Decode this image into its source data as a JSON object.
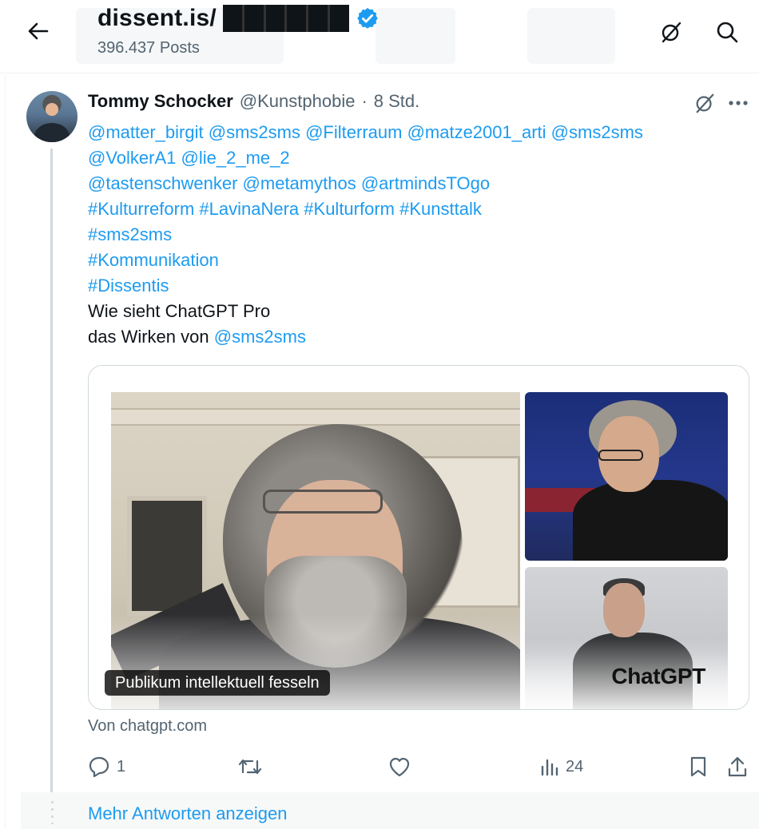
{
  "header": {
    "title": "dissent.is/",
    "post_count": "396.437 Posts"
  },
  "tweet": {
    "display_name": "Tommy Schocker",
    "handle": "@Kunstphobie",
    "separator": "·",
    "time": "8 Std.",
    "lines": [
      [
        {
          "t": "@matter_birgit",
          "link": true
        },
        {
          "t": " ",
          "link": false
        },
        {
          "t": "@sms2sms",
          "link": true
        },
        {
          "t": " ",
          "link": false
        },
        {
          "t": "@Filterraum",
          "link": true
        },
        {
          "t": " ",
          "link": false
        },
        {
          "t": "@matze2001_arti",
          "link": true
        },
        {
          "t": " ",
          "link": false
        },
        {
          "t": "@sms2sms",
          "link": true
        }
      ],
      [
        {
          "t": "@VolkerA1",
          "link": true
        },
        {
          "t": " ",
          "link": false
        },
        {
          "t": "@lie_2_me_2",
          "link": true
        }
      ],
      [
        {
          "t": "@tastenschwenker",
          "link": true
        },
        {
          "t": " ",
          "link": false
        },
        {
          "t": "@metamythos",
          "link": true
        },
        {
          "t": " ",
          "link": false
        },
        {
          "t": "@artmindsTOgo",
          "link": true
        }
      ],
      [
        {
          "t": "#Kulturreform",
          "link": true
        },
        {
          "t": " ",
          "link": false
        },
        {
          "t": "#LavinaNera",
          "link": true
        },
        {
          "t": " ",
          "link": false
        },
        {
          "t": "#Kulturform",
          "link": true
        },
        {
          "t": " ",
          "link": false
        },
        {
          "t": "#Kunsttalk",
          "link": true
        }
      ],
      [
        {
          "t": "#sms2sms",
          "link": true
        }
      ],
      [
        {
          "t": "#Kommunikation",
          "link": true
        }
      ],
      [
        {
          "t": "#Dissentis",
          "link": true
        }
      ],
      [
        {
          "t": "Wie sieht ChatGPT Pro",
          "link": false
        }
      ],
      [
        {
          "t": "das Wirken von ",
          "link": false
        },
        {
          "t": "@sms2sms",
          "link": true
        }
      ]
    ],
    "card": {
      "alt_badge": "Publikum intellektuell fesseln",
      "brand_label": "ChatGPT"
    },
    "source": "Von chatgpt.com",
    "actions": {
      "replies": "1",
      "views": "24"
    }
  },
  "more_replies": "Mehr Antworten anzeigen",
  "colors": {
    "link": "#1d9bf0",
    "muted": "#536471",
    "verified": "#1d9bf0"
  },
  "icons": [
    "back-arrow-icon",
    "verified-badge-icon",
    "grok-slash-icon",
    "search-icon",
    "more-dots-icon",
    "reply-icon",
    "repost-icon",
    "like-icon",
    "views-icon",
    "bookmark-icon",
    "share-icon"
  ]
}
